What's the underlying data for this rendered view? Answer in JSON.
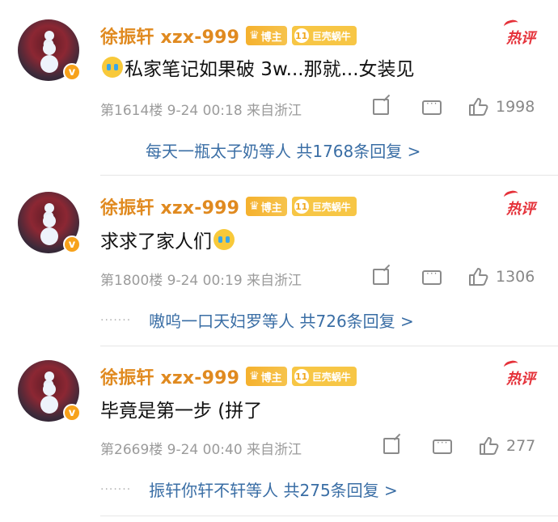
{
  "comments": [
    {
      "username": "徐振轩 xzx-999",
      "badge_bozhu": "博主",
      "badge_level": "11",
      "badge_snail": "巨壳蜗牛",
      "hot_label": "热评",
      "text_before": "",
      "text_after": "私家笔记如果破 3w...那就...女装见",
      "emoji": "crying-face",
      "floor_time_source": "第1614楼 9-24 00:18 来自浙江",
      "likes": "1998",
      "reply_dots": "",
      "reply_text": "每天一瓶太子奶等人 共1768条回复 >"
    },
    {
      "username": "徐振轩 xzx-999",
      "badge_bozhu": "博主",
      "badge_level": "11",
      "badge_snail": "巨壳蜗牛",
      "hot_label": "热评",
      "text_before": "求求了家人们",
      "text_after": "",
      "emoji": "crying-face",
      "floor_time_source": "第1800楼 9-24 00:19 来自浙江",
      "likes": "1306",
      "reply_dots": "·······",
      "reply_text": "嗷呜一口天妇罗等人 共726条回复 >"
    },
    {
      "username": "徐振轩 xzx-999",
      "badge_bozhu": "博主",
      "badge_level": "11",
      "badge_snail": "巨壳蜗牛",
      "hot_label": "热评",
      "text_before": "毕竟是第一步 (拼了",
      "text_after": "",
      "emoji": "",
      "floor_time_source": "第2669楼 9-24 00:40 来自浙江",
      "likes": "277",
      "reply_dots": "·······",
      "reply_text": "振轩你轩不轩等人 共275条回复 >"
    }
  ],
  "colors": {
    "username": "#e08a20",
    "hot": "#e5323a",
    "reply_link": "#3a6ea5",
    "meta": "#9b9b9b"
  }
}
